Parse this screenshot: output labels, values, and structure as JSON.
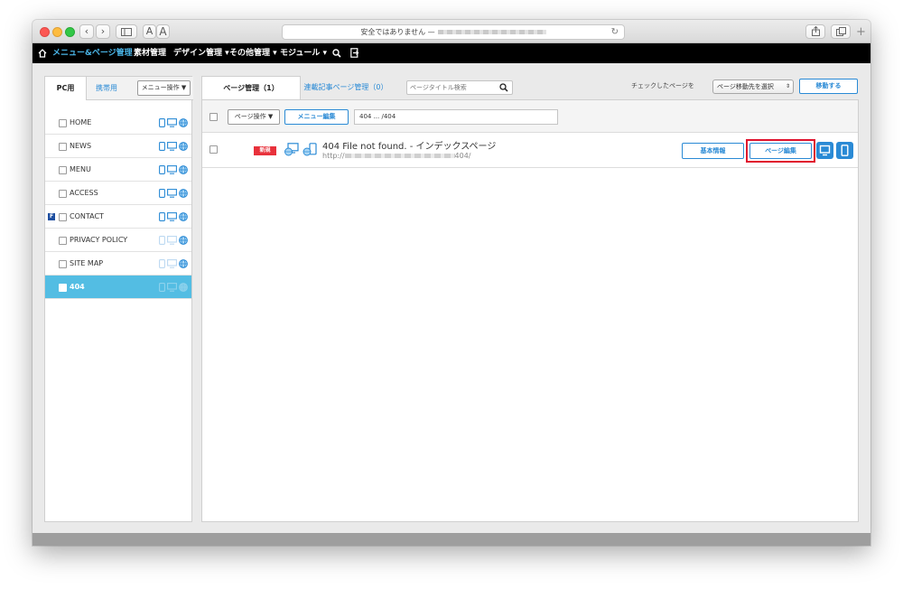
{
  "browser": {
    "address_text": "安全ではありません —",
    "font_small": "A",
    "font_large": "A"
  },
  "nav": {
    "items": [
      {
        "label": "メニュー&ページ管理",
        "active": true
      },
      {
        "label": "素材管理"
      },
      {
        "label": "デザイン管理 ▾"
      },
      {
        "label": "その他管理 ▾"
      },
      {
        "label": "モジュール ▾"
      }
    ]
  },
  "left": {
    "tab_pc": "PC用",
    "tab_mobile": "携帯用",
    "menu_op": "メニュー操作 ▼",
    "pages": [
      {
        "label": "HOME"
      },
      {
        "label": "NEWS"
      },
      {
        "label": "MENU"
      },
      {
        "label": "ACCESS"
      },
      {
        "label": "CONTACT",
        "badge": "F"
      },
      {
        "label": "PRIVACY POLICY"
      },
      {
        "label": "SITE MAP"
      },
      {
        "label": "404"
      }
    ]
  },
  "right": {
    "tab_page": "ページ管理（1）",
    "tab_series": "連載記事ページ管理（0）",
    "search_placeholder": "ページタイトル検索",
    "checked_label": "チェックしたページを",
    "move_select": "ページ移動先を選択",
    "move_button": "移動する",
    "page_op": "ページ操作 ▼",
    "menu_edit": "メニュー編集",
    "path": "404 ... /404",
    "row": {
      "badge": "新規",
      "title": "404 File not found. - インデックスページ",
      "url_prefix": "http://",
      "url_suffix": "404/",
      "basic_info": "基本情報",
      "page_edit": "ページ編集"
    }
  },
  "colors": {
    "accent": "#2a8ad5",
    "active_row": "#53bde3",
    "badge_red": "#e8313b",
    "highlight": "#e0122d"
  }
}
